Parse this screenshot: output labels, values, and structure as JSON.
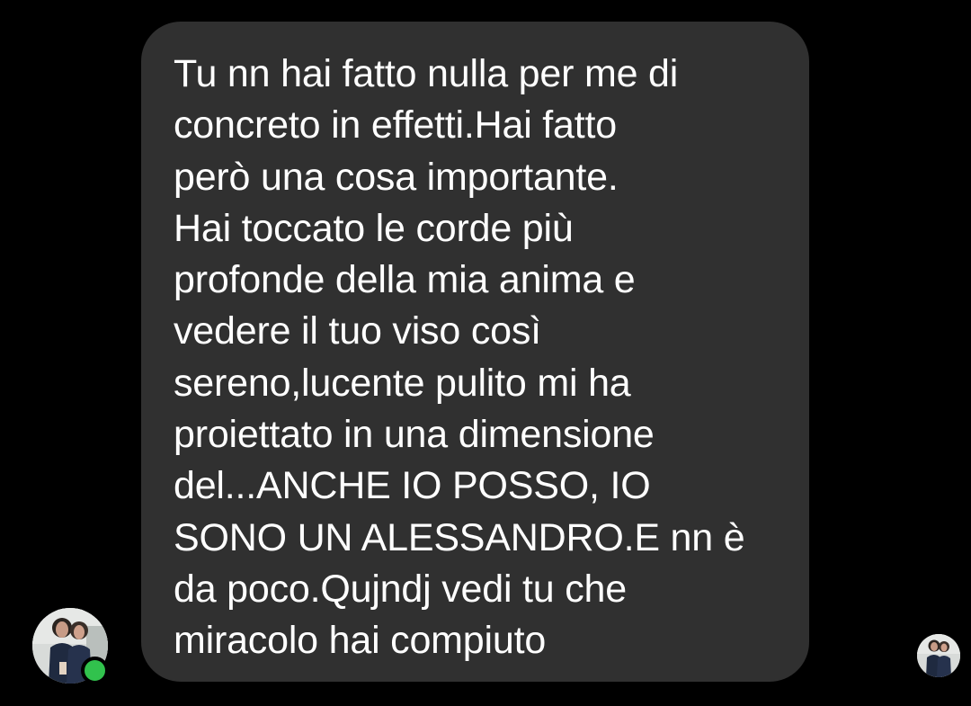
{
  "message": {
    "lines": [
      "Tu nn hai fatto nulla per me di",
      "concreto in effetti.Hai fatto",
      "però una cosa importante.",
      "Hai toccato le corde più",
      "profonde della mia anima e",
      "vedere il tuo viso così",
      "sereno,lucente pulito mi ha",
      "proiettato in una dimensione",
      "del...ANCHE IO POSSO, IO",
      "SONO UN ALESSANDRO.E nn è",
      "da poco.Qujndj vedi tu che",
      "miracolo hai compiuto"
    ]
  },
  "sender": {
    "status": "online",
    "status_color": "#31c24d"
  },
  "colors": {
    "background": "#000000",
    "bubble": "#303030",
    "text": "#ffffff"
  }
}
